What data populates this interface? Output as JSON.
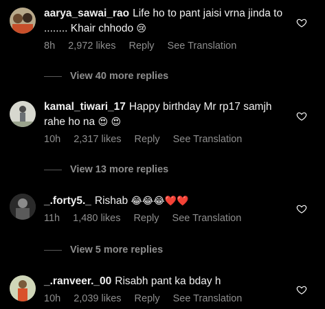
{
  "comments": [
    {
      "username": "aarya_sawai_rao",
      "text": "Life ho to pant jaisi vrna jinda to ........ Khair chhodo",
      "emoji": "😢",
      "time": "8h",
      "likes": "2,972 likes",
      "reply": "Reply",
      "translate": "See Translation",
      "more_replies": "View 40 more replies"
    },
    {
      "username": "kamal_tiwari_17",
      "text": "Happy birthday Mr rp17 samjh rahe ho na",
      "emoji": "😍 😍",
      "time": "10h",
      "likes": "2,317 likes",
      "reply": "Reply",
      "translate": "See Translation",
      "more_replies": "View 13 more replies"
    },
    {
      "username": "_.forty5._",
      "text": "Rishab",
      "emoji": "😂😂😂❤️❤️",
      "time": "11h",
      "likes": "1,480 likes",
      "reply": "Reply",
      "translate": "See Translation",
      "more_replies": "View 5 more replies"
    },
    {
      "username": "_.ranveer._00",
      "text": "Risabh pant ka bday h",
      "emoji": "",
      "time": "10h",
      "likes": "2,039 likes",
      "reply": "Reply",
      "translate": "See Translation"
    }
  ],
  "icons": {
    "like": "heart-outline-icon"
  },
  "colors": {
    "background": "#000000",
    "text": "#f5f5f5",
    "muted": "#8e8e8e"
  }
}
